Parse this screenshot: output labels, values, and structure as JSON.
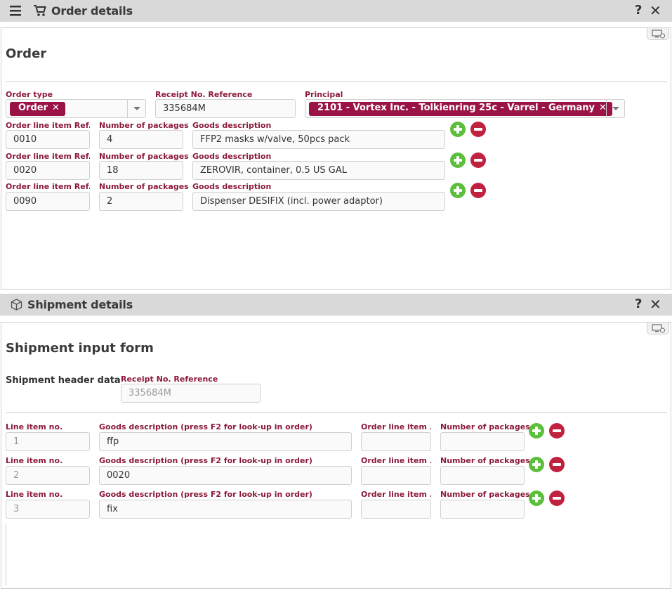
{
  "order_panel": {
    "title": "Order details",
    "help": "?",
    "close": "✕",
    "section_title": "Order",
    "order_type": {
      "label": "Order type",
      "chip": "Order"
    },
    "receipt_ref": {
      "label": "Receipt No. Reference",
      "value": "335684M"
    },
    "principal": {
      "label": "Principal",
      "chip": "2101 - Vortex Inc. - Tolkienring 25c - Varrel - Germany"
    },
    "lines": [
      {
        "ref_label": "Order line item Ref...",
        "ref": "0010",
        "pkg_label": "Number of packages",
        "pkg": "4",
        "desc_label": "Goods description",
        "desc": "FFP2 masks w/valve, 50pcs pack"
      },
      {
        "ref_label": "Order line item Ref...",
        "ref": "0020",
        "pkg_label": "Number of packages",
        "pkg": "18",
        "desc_label": "Goods description",
        "desc": "ZEROVIR, container, 0.5 US GAL"
      },
      {
        "ref_label": "Order line item Ref...",
        "ref": "0090",
        "pkg_label": "Number of packages",
        "pkg": "2",
        "desc_label": "Goods description",
        "desc": "Dispenser DESIFIX (incl. power adaptor)"
      }
    ]
  },
  "shipment_panel": {
    "title": "Shipment details",
    "help": "?",
    "close": "✕",
    "section_title": "Shipment input form",
    "header_label": "Shipment header data",
    "receipt_ref": {
      "label": "Receipt No. Reference",
      "value": "335684M"
    },
    "lines": [
      {
        "no_label": "Line item no.",
        "no": "1",
        "desc_label": "Goods description (press F2 for look-up in order)",
        "desc": "ffp",
        "ref_label": "Order line item ...",
        "ref": "",
        "pkg_label": "Number of packages",
        "pkg": ""
      },
      {
        "no_label": "Line item no.",
        "no": "2",
        "desc_label": "Goods description (press F2 for look-up in order)",
        "desc": "0020",
        "ref_label": "Order line item ...",
        "ref": "",
        "pkg_label": "Number of packages",
        "pkg": ""
      },
      {
        "no_label": "Line item no.",
        "no": "3",
        "desc_label": "Goods description (press F2 for look-up in order)",
        "desc": "fix",
        "ref_label": "Order line item ...",
        "ref": "",
        "pkg_label": "Number of packages",
        "pkg": ""
      }
    ]
  },
  "colors": {
    "accent": "#9b1346",
    "label": "#8b1a3a",
    "add": "#5cbf3c",
    "remove": "#c0213f",
    "header_bg": "#d9d9d9"
  }
}
